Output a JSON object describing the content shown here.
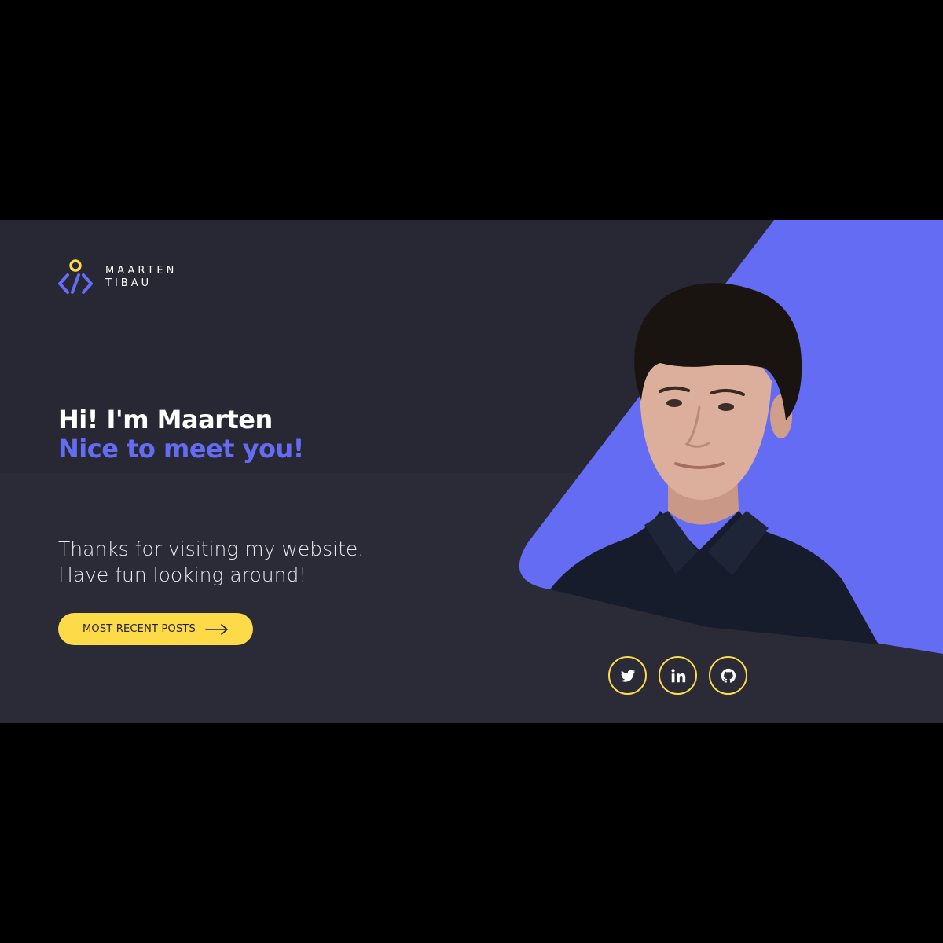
{
  "brand": {
    "name_line1": "MAARTEN",
    "name_line2": "TIBAU",
    "logo_icon": "code-pin-icon"
  },
  "hero": {
    "greeting": "Hi! I'm Maarten",
    "tagline": "Nice to meet you!",
    "intro_line1": "Thanks for visiting my website.",
    "intro_line2": "Have fun looking around!",
    "cta_label": "MOST RECENT POSTS",
    "cta_icon": "arrow-right-icon"
  },
  "socials": [
    {
      "name": "Twitter",
      "icon": "twitter-icon"
    },
    {
      "name": "LinkedIn",
      "icon": "linkedin-icon"
    },
    {
      "name": "GitHub",
      "icon": "github-icon"
    }
  ],
  "colors": {
    "background": "#2b2b38",
    "accent": "#646cf3",
    "highlight": "#fdda48",
    "letterbox": "#000000"
  }
}
